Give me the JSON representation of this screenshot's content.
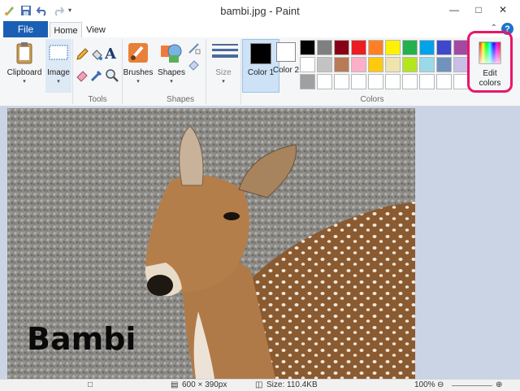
{
  "window": {
    "title": "bambi.jpg - Paint",
    "minimize": "—",
    "maximize": "□",
    "close": "✕"
  },
  "tabs": {
    "file": "File",
    "home": "Home",
    "view": "View",
    "help": "?"
  },
  "ribbon": {
    "clipboard": "Clipboard",
    "image": "Image",
    "tools_group": "Tools",
    "brushes": "Brushes",
    "shapes": "Shapes",
    "shapes_group": "Shapes",
    "size": "Size",
    "color1": "Color 1",
    "color2": "Color 2",
    "colors_group": "Colors",
    "edit_colors": "Edit colors",
    "dropdown": "▾"
  },
  "colors": {
    "color1_value": "#000000",
    "color2_value": "#ffffff",
    "accent_highlight": "#e8176a",
    "palette_row1": [
      "#000000",
      "#7f7f7f",
      "#880015",
      "#ed1c24",
      "#ff7f27",
      "#fff200",
      "#22b14c",
      "#00a2e8",
      "#3f48cc",
      "#a349a4"
    ],
    "palette_row2": [
      "#ffffff",
      "#c3c3c3",
      "#b97a57",
      "#ffaec9",
      "#ffc90e",
      "#efe4b0",
      "#b5e61d",
      "#99d9ea",
      "#7092be",
      "#c8bfe7"
    ],
    "palette_row3": [
      "#a0a0a0",
      "#ffffff",
      "#ffffff",
      "#ffffff",
      "#ffffff",
      "#ffffff",
      "#ffffff",
      "#ffffff",
      "#ffffff",
      "#ffffff"
    ]
  },
  "canvas": {
    "text": "Bambi"
  },
  "status": {
    "dimensions": "600 × 390px",
    "size": "Size: 110.4KB",
    "zoom": "100%"
  }
}
